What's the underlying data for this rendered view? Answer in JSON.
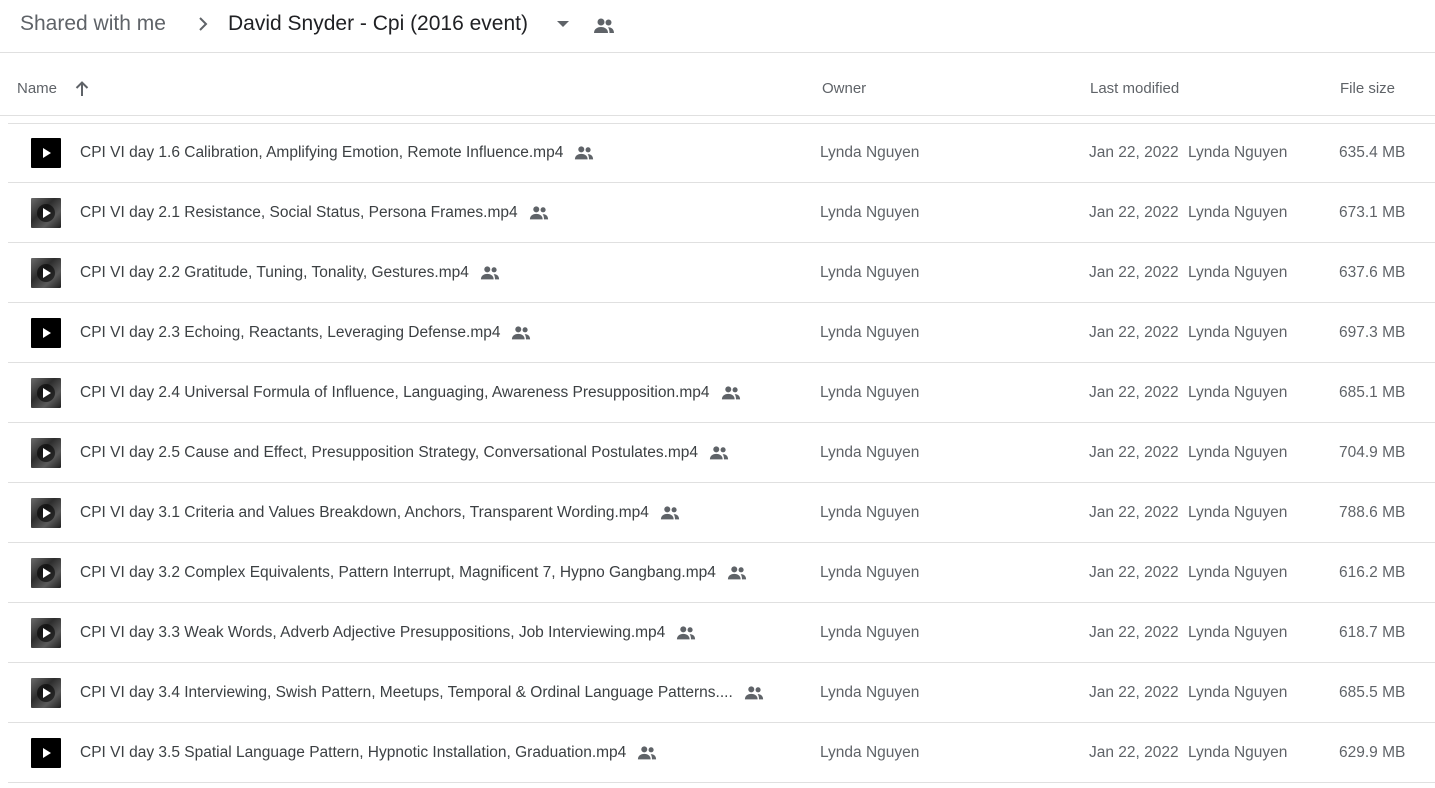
{
  "breadcrumb": {
    "root": "Shared with me",
    "current": "David Snyder - Cpi (2016 event)"
  },
  "icons": {
    "separator": "chevron-right-icon",
    "caret": "caret-down-icon",
    "shared": "people-icon",
    "sort": "arrow-up-icon",
    "video": "play-icon"
  },
  "columns": {
    "name": "Name",
    "owner": "Owner",
    "last_modified": "Last modified",
    "file_size": "File size"
  },
  "files": [
    {
      "name": "CPI VI day 1.6 Calibration, Amplifying Emotion, Remote Influence.mp4",
      "owner": "Lynda Nguyen",
      "modified_date": "Jan 22, 2022",
      "modified_by": "Lynda Nguyen",
      "size": "635.4 MB",
      "thumb": "plain"
    },
    {
      "name": "CPI VI day 2.1 Resistance, Social Status, Persona Frames.mp4",
      "owner": "Lynda Nguyen",
      "modified_date": "Jan 22, 2022",
      "modified_by": "Lynda Nguyen",
      "size": "673.1 MB",
      "thumb": "photo"
    },
    {
      "name": "CPI VI day 2.2 Gratitude, Tuning, Tonality, Gestures.mp4",
      "owner": "Lynda Nguyen",
      "modified_date": "Jan 22, 2022",
      "modified_by": "Lynda Nguyen",
      "size": "637.6 MB",
      "thumb": "photo"
    },
    {
      "name": "CPI VI day 2.3 Echoing, Reactants, Leveraging Defense.mp4",
      "owner": "Lynda Nguyen",
      "modified_date": "Jan 22, 2022",
      "modified_by": "Lynda Nguyen",
      "size": "697.3 MB",
      "thumb": "plain"
    },
    {
      "name": "CPI VI day 2.4 Universal Formula of Influence, Languaging, Awareness Presupposition.mp4",
      "owner": "Lynda Nguyen",
      "modified_date": "Jan 22, 2022",
      "modified_by": "Lynda Nguyen",
      "size": "685.1 MB",
      "thumb": "photo"
    },
    {
      "name": "CPI VI day 2.5 Cause and Effect, Presupposition Strategy, Conversational Postulates.mp4",
      "owner": "Lynda Nguyen",
      "modified_date": "Jan 22, 2022",
      "modified_by": "Lynda Nguyen",
      "size": "704.9 MB",
      "thumb": "photo"
    },
    {
      "name": "CPI VI day 3.1 Criteria and Values Breakdown, Anchors, Transparent Wording.mp4",
      "owner": "Lynda Nguyen",
      "modified_date": "Jan 22, 2022",
      "modified_by": "Lynda Nguyen",
      "size": "788.6 MB",
      "thumb": "photo"
    },
    {
      "name": "CPI VI day 3.2 Complex Equivalents, Pattern Interrupt, Magnificent 7, Hypno Gangbang.mp4",
      "owner": "Lynda Nguyen",
      "modified_date": "Jan 22, 2022",
      "modified_by": "Lynda Nguyen",
      "size": "616.2 MB",
      "thumb": "photo"
    },
    {
      "name": "CPI VI day 3.3 Weak Words, Adverb Adjective Presuppositions, Job Interviewing.mp4",
      "owner": "Lynda Nguyen",
      "modified_date": "Jan 22, 2022",
      "modified_by": "Lynda Nguyen",
      "size": "618.7 MB",
      "thumb": "photo"
    },
    {
      "name": "CPI VI day 3.4 Interviewing, Swish Pattern, Meetups, Temporal & Ordinal Language Patterns....",
      "owner": "Lynda Nguyen",
      "modified_date": "Jan 22, 2022",
      "modified_by": "Lynda Nguyen",
      "size": "685.5 MB",
      "thumb": "photo"
    },
    {
      "name": "CPI VI day 3.5 Spatial Language Pattern, Hypnotic Installation, Graduation.mp4",
      "owner": "Lynda Nguyen",
      "modified_date": "Jan 22, 2022",
      "modified_by": "Lynda Nguyen",
      "size": "629.9 MB",
      "thumb": "plain"
    }
  ]
}
